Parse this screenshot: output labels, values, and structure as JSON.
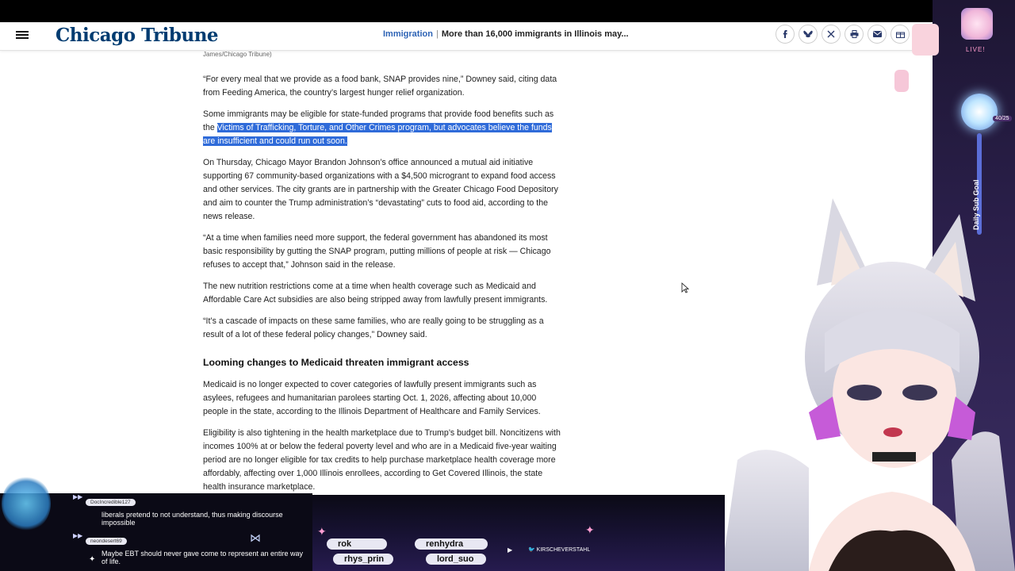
{
  "header": {
    "logo": "Chicago Tribune",
    "section": "Immigration",
    "separator": "|",
    "headline": "More than 16,000 immigrants in Illinois may...",
    "share_icons": [
      "facebook-icon",
      "bluesky-icon",
      "x-icon",
      "print-icon",
      "email-icon",
      "gift-icon"
    ]
  },
  "article": {
    "caption": "James/Chicago Tribune)",
    "p1": "“For every meal that we provide as a food bank, SNAP provides nine,” Downey said, citing data from Feeding America, the country’s largest hunger relief organization.",
    "p2_before": "Some immigrants may be eligible for state-funded programs that provide food benefits such as the ",
    "p2_highlight": "Victims of Trafficking, Torture, and Other Crimes program, but advocates believe the funds are insufficient and could run out soon.",
    "p3": "On Thursday, Chicago Mayor Brandon Johnson’s office announced a mutual aid initiative supporting 67 community-based organizations with a $4,500 microgrant to expand food access and other services. The city grants are in partnership with the Greater Chicago Food Depository and aim to counter the Trump administration’s “devastating” cuts to food aid, according to the news release.",
    "p4": "“At a time when families need more support, the federal government has abandoned its most basic responsibility by gutting the SNAP program, putting millions of people at risk — Chicago refuses to accept that,” Johnson said in the release.",
    "p5": "The new nutrition restrictions come at a time when health coverage such as Medicaid and Affordable Care Act subsidies are also being stripped away from lawfully present immigrants.",
    "p6": "“It’s a cascade of impacts on these same families, who are really going to be struggling as a result of a lot of these federal policy changes,” Downey said.",
    "h2": "Looming changes to Medicaid threaten immigrant access",
    "p7": "Medicaid is no longer expected to cover categories of lawfully present immigrants such as asylees, refugees and humanitarian parolees starting Oct. 1, 2026, affecting about 10,000 people in the state, according to the Illinois Department of Healthcare and Family Services.",
    "p8": "Eligibility is also tightening in the health marketplace due to Trump’s budget bill. Noncitizens with incomes 100% at or below the federal poverty level and who are in a Medicaid five-year waiting period are no longer eligible for tax credits to help purchase marketplace health coverage more affordably, affecting over 1,000 Illinois enrollees, according to Get Covered Illinois, the state health insurance marketplace."
  },
  "stream_overlay": {
    "live_label": "LIVE!",
    "goal_label": "Daily Sub Goal",
    "goal_count": "40/25",
    "chat": [
      {
        "user": "DocIncredible127",
        "text": "liberals pretend to not understand, thus making discourse impossible"
      },
      {
        "user": "neondesert69",
        "text": "Maybe EBT should never gave come to represent an entire way of life."
      }
    ],
    "names_row1": [
      "rok",
      "renhydra"
    ],
    "names_row2": [
      "rhys_prin",
      "lord_suo"
    ],
    "twitter_handle": "KIRSCHEVERSTAHL",
    "accent_colors": {
      "highlight": "#2f6bd9",
      "brand": "#003c71",
      "section_link": "#2d63b5"
    }
  }
}
